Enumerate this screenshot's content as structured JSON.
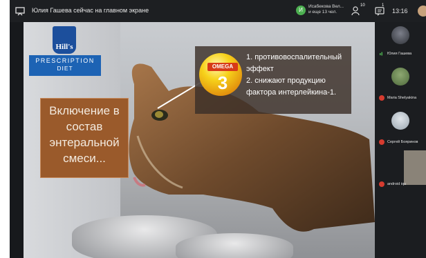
{
  "topbar": {
    "title": "Юлия Гашева сейчас на главном экране",
    "presenter_initial": "И",
    "presenter_name": "Исабекова Вел...",
    "presenter_sub": "и еще 13 чел.",
    "participants_badge": "10",
    "chat_badge": "1",
    "time": "13:16"
  },
  "slide": {
    "brand": "Hill's",
    "line1": "PRESCRIPTION",
    "line2": "DIET",
    "box_text": "Включение в состав энтеральной смеси...",
    "omega_label": "OMEGA",
    "omega_number": "3",
    "points": "1. противовоспалительный эффект\n2. снижают продукцию фактора интерлейкина-1."
  },
  "participants": [
    {
      "name": "Юлия Гашева",
      "mic": "on"
    },
    {
      "name": "Maria Shelyakina",
      "mic": "off"
    },
    {
      "name": "Сергей Бояринов",
      "mic": "off"
    },
    {
      "name": "android iqu",
      "mic": "off"
    }
  ],
  "colors": {
    "accent_green": "#4caf50",
    "brand_blue": "#1d63b4",
    "slide_box_brown": "#9a5a2b",
    "mic_off_red": "#d63b2f"
  }
}
